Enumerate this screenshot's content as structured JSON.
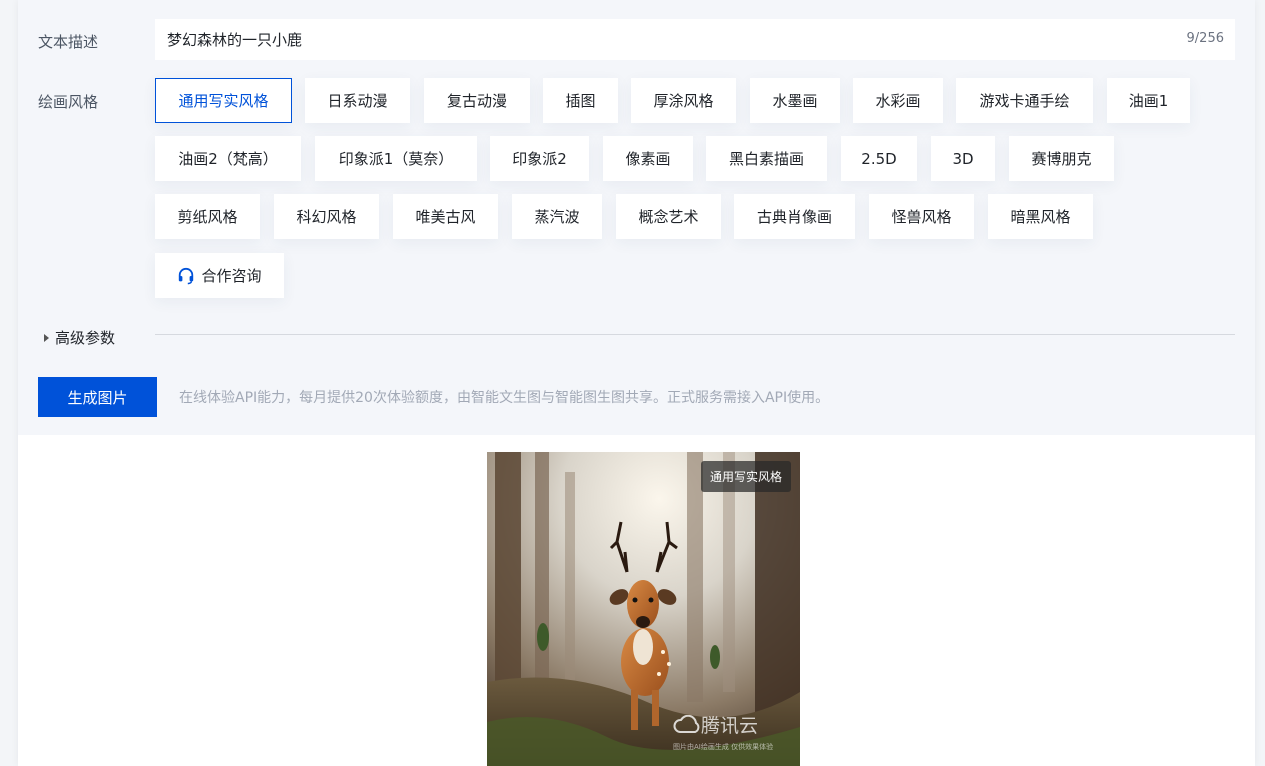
{
  "prompt": {
    "label": "文本描述",
    "value": "梦幻森林的一只小鹿",
    "counter": "9/256"
  },
  "styles": {
    "label": "绘画风格",
    "items": [
      "通用写实风格",
      "日系动漫",
      "复古动漫",
      "插图",
      "厚涂风格",
      "水墨画",
      "水彩画",
      "游戏卡通手绘",
      "油画1",
      "油画2（梵高）",
      "印象派1（莫奈）",
      "印象派2",
      "像素画",
      "黑白素描画",
      "2.5D",
      "3D",
      "赛博朋克",
      "剪纸风格",
      "科幻风格",
      "唯美古风",
      "蒸汽波",
      "概念艺术",
      "古典肖像画",
      "怪兽风格",
      "暗黑风格"
    ],
    "selected": "通用写实风格",
    "consult": "合作咨询"
  },
  "advanced": {
    "label": "高级参数"
  },
  "generate": {
    "button": "生成图片",
    "note": "在线体验API能力，每月提供20次体验额度，由智能文生图与智能图生图共享。正式服务需接入API使用。"
  },
  "result": {
    "tag": "通用写实风格",
    "watermark": "腾讯云",
    "watermark_sub": "图片由AI绘画生成 仅供效果体验"
  },
  "colors": {
    "accent": "#0052d9",
    "note": "#a2a9b6"
  }
}
